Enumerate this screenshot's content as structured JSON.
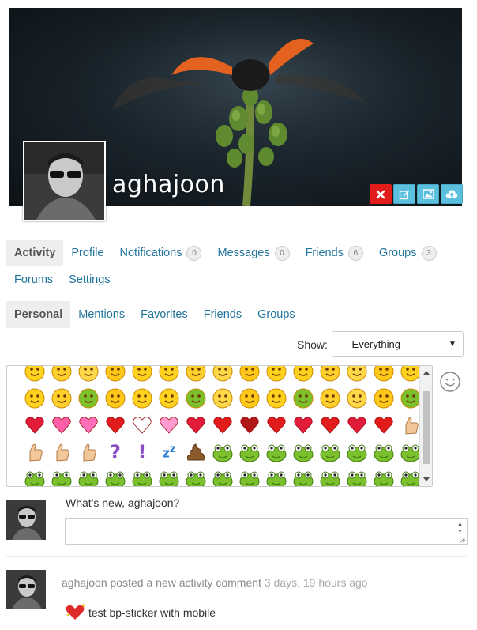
{
  "profile": {
    "username": "aghajoon"
  },
  "cover_buttons": [
    {
      "name": "delete-cover-button",
      "icon": "close-icon",
      "color": "#e21b1b"
    },
    {
      "name": "edit-cover-button",
      "icon": "edit-icon",
      "color": "#5bc0de"
    },
    {
      "name": "change-cover-image-button",
      "icon": "image-icon",
      "color": "#5bc0de"
    },
    {
      "name": "upload-cover-button",
      "icon": "cloud-upload-icon",
      "color": "#5bc0de"
    }
  ],
  "main_nav": {
    "activity": "Activity",
    "profile": "Profile",
    "notifications": "Notifications",
    "notifications_count": "0",
    "messages": "Messages",
    "messages_count": "0",
    "friends": "Friends",
    "friends_count": "6",
    "groups": "Groups",
    "groups_count": "3",
    "forums": "Forums",
    "settings": "Settings"
  },
  "sub_nav": {
    "personal": "Personal",
    "mentions": "Mentions",
    "favorites": "Favorites",
    "friends": "Friends",
    "groups": "Groups"
  },
  "filter": {
    "label": "Show:",
    "selected": "— Everything —"
  },
  "post_form": {
    "prompt": "What's new, aghajoon?"
  },
  "activity": {
    "user": "aghajoon",
    "action": "posted a new activity comment",
    "time": "3 days, 19 hours ago",
    "content": "test bp-sticker with mobile"
  },
  "colors": {
    "link": "#21759b",
    "accent_blue": "#5bc0de",
    "danger": "#e21b1b"
  }
}
